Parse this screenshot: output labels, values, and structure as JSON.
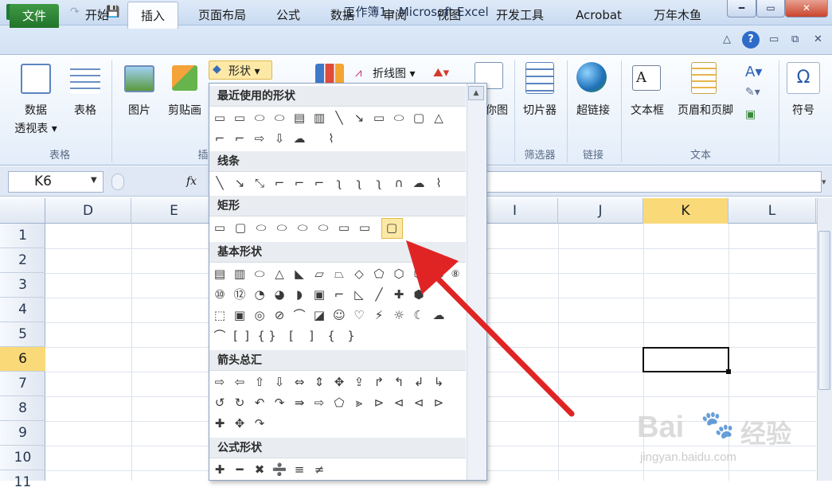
{
  "window": {
    "title": "工作簿1 - Microsoft Excel",
    "min": "━",
    "max": "▭",
    "close": "✕"
  },
  "quick_access": [
    "↶",
    "↷",
    "💾",
    "🗋",
    "🗁"
  ],
  "tabs": [
    "文件",
    "开始",
    "插入",
    "页面布局",
    "公式",
    "数据",
    "审阅",
    "视图",
    "开发工具",
    "Acrobat",
    "万年木鱼"
  ],
  "ribbon": {
    "pivot": [
      "数据",
      "透视表 ▾"
    ],
    "table": "表格",
    "picture": "图片",
    "clipart": "剪贴画",
    "shapes": "形状 ▾",
    "line_chart": "折线图 ▾",
    "chart_partial": "你图",
    "slicer": "切片器",
    "hyperlink": "超链接",
    "textbox": "文本框",
    "header_footer": "页眉和页脚",
    "symbol": "符号",
    "groups": {
      "tables": "表格",
      "illus": "插",
      "filter": "筛选器",
      "links": "链接",
      "text": "文本"
    }
  },
  "formula": {
    "cell": "K6",
    "fx": "fx"
  },
  "columns": [
    "D",
    "E",
    "I",
    "J",
    "K",
    "L"
  ],
  "rows": [
    "1",
    "2",
    "3",
    "4",
    "5",
    "6",
    "7",
    "8",
    "9",
    "10",
    "11"
  ],
  "shapes_menu": {
    "recent": "最近使用的形状",
    "lines": "线条",
    "rect": "矩形",
    "basic": "基本形状",
    "arrows": "箭头总汇",
    "equation": "公式形状",
    "recent_row1": [
      "▭",
      "▭",
      "⬭",
      "⬭",
      "▤",
      "▥",
      "╲",
      "↘",
      "▭",
      "⬭",
      "▢",
      "△"
    ],
    "recent_row2": [
      "⌐",
      "⌐",
      "⇨",
      "⇩",
      "☁",
      "⌇"
    ],
    "lines_row": [
      "╲",
      "↘",
      "⤡",
      "⌐",
      "⌐",
      "⌐",
      "ʅ",
      "ʅ",
      "ʅ",
      "∩",
      "☁",
      "⌇"
    ],
    "rect_row": [
      "▭",
      "▢",
      "⬭",
      "⬭",
      "⬭",
      "⬭",
      "▭",
      "▭",
      "▢"
    ],
    "basic_row1": [
      "▤",
      "▥",
      "⬭",
      "△",
      "◣",
      "▱",
      "⏢",
      "◇",
      "⬠",
      "⬡",
      "⬡",
      "⬡",
      "⑧"
    ],
    "basic_row2": [
      "⑩",
      "⑫",
      "◔",
      "◕",
      "◗",
      "▣",
      "⌐",
      "◺",
      "╱",
      "✚",
      "⬢"
    ],
    "basic_row3": [
      "⬚",
      "▣",
      "◎",
      "⊘",
      "⌒",
      "◪",
      "☺",
      "♡",
      "⚡",
      "☼",
      "☾",
      "☁"
    ],
    "basic_row4": [
      "⌒",
      "[",
      "]",
      "{",
      "}",
      "[",
      "]",
      "{",
      "}"
    ],
    "arrow_row1": [
      "⇨",
      "⇦",
      "⇧",
      "⇩",
      "⇔",
      "⇕",
      "✥",
      "⇪",
      "↱",
      "↰",
      "↲",
      "↳"
    ],
    "arrow_row2": [
      "↺",
      "↻",
      "↶",
      "↷",
      "⇛",
      "⇨",
      "⬠",
      "⪢",
      "⊳",
      "⊲",
      "⊲",
      "⊳"
    ],
    "arrow_row3": [
      "✚",
      "✥",
      "↷"
    ],
    "eq_row": [
      "✚",
      "━",
      "✖",
      "➗",
      "≡",
      "≠"
    ]
  },
  "watermark": {
    "brand": "Bai",
    "brand2": "经验",
    "url": "jingyan.baidu.com"
  }
}
